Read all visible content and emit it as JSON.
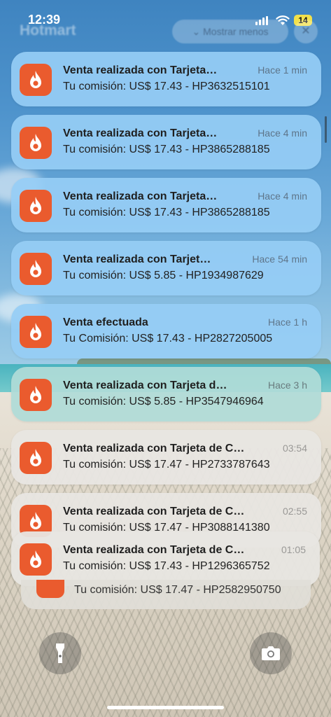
{
  "status_bar": {
    "time": "12:39",
    "battery": "14"
  },
  "background_header": {
    "app_name": "Hotmart",
    "show_less_label": "Mostrar menos",
    "close_label": "✕"
  },
  "notifications": [
    {
      "title": "Venta realizada con Tarjeta…",
      "body": "Tu comisión: US$ 17.43 - HP3632515101",
      "time": "Hace 1 min"
    },
    {
      "title": "Venta realizada con Tarjeta…",
      "body": "Tu comisión: US$ 17.43 - HP3865288185",
      "time": "Hace 4 min"
    },
    {
      "title": "Venta realizada con Tarjeta…",
      "body": "Tu comisión: US$ 17.43 - HP3865288185",
      "time": "Hace 4 min"
    },
    {
      "title": "Venta realizada con Tarjet…",
      "body": "Tu comisión: US$ 5.85 - HP1934987629",
      "time": "Hace 54 min"
    },
    {
      "title": "Venta efectuada",
      "body": "Tu Comisión: US$ 17.43 - HP2827205005",
      "time": "Hace 1 h"
    },
    {
      "title": "Venta realizada con Tarjeta d…",
      "body": "Tu comisión: US$ 5.85 - HP3547946964",
      "time": "Hace 3 h"
    },
    {
      "title": "Venta realizada con Tarjeta de C…",
      "body": "Tu comisión: US$ 17.47 - HP2733787643",
      "time": "03:54"
    },
    {
      "title": "Venta realizada con Tarjeta de C…",
      "body": "Tu comisión: US$ 17.47 - HP3088141380",
      "time": "02:55"
    },
    {
      "title": "Venta realizada con Tarjeta de C…",
      "body": "Tu comisión: US$ 17.43 - HP1296365752",
      "time": "01:05"
    }
  ],
  "stacked_notification": {
    "body": "Tu comisión: US$ 17.47 - HP2582950750"
  },
  "icons": {
    "app": "hotmart-flame-icon",
    "flashlight": "flashlight-icon",
    "camera": "camera-icon"
  },
  "colors": {
    "brand": "#ea5b2e"
  }
}
